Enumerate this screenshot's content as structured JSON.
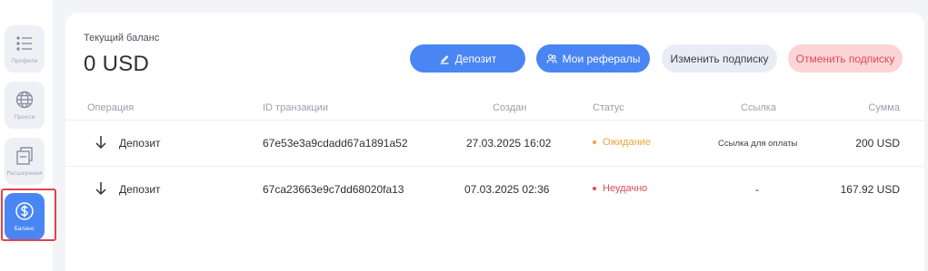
{
  "sidebar": {
    "items": [
      {
        "label": "Профили",
        "icon": "list-icon"
      },
      {
        "label": "Прокси",
        "icon": "globe-icon"
      },
      {
        "label": "Расширения",
        "icon": "extension-icon"
      },
      {
        "label": "Баланс",
        "icon": "dollar-icon",
        "active": true
      }
    ]
  },
  "balance": {
    "label": "Текущий баланс",
    "value": "0 USD"
  },
  "actions": {
    "deposit": "Депозит",
    "referrals": "Мои рефералы",
    "change_subscription": "Изменить подписку",
    "cancel_subscription": "Отменить подписку"
  },
  "table": {
    "columns": [
      "Операция",
      "ID транзакции",
      "Создан",
      "Статус",
      "Ссылка",
      "Сумма"
    ],
    "rows": [
      {
        "operation": "Депозит",
        "id": "67e53e3a9cdadd67a1891a52",
        "created": "27.03.2025 16:02",
        "status": "Ожидание",
        "status_color": "#f0a23a",
        "link": "Ссылка для оплаты",
        "amount": "200 USD"
      },
      {
        "operation": "Депозит",
        "id": "67ca23663e9c7dd68020fa13",
        "created": "07.03.2025 02:36",
        "status": "Неудачно",
        "status_color": "#e04b55",
        "link": "-",
        "amount": "167.92 USD"
      }
    ]
  },
  "colors": {
    "accent": "#4a86f3",
    "pending": "#f0a23a",
    "failed": "#e04b55"
  }
}
